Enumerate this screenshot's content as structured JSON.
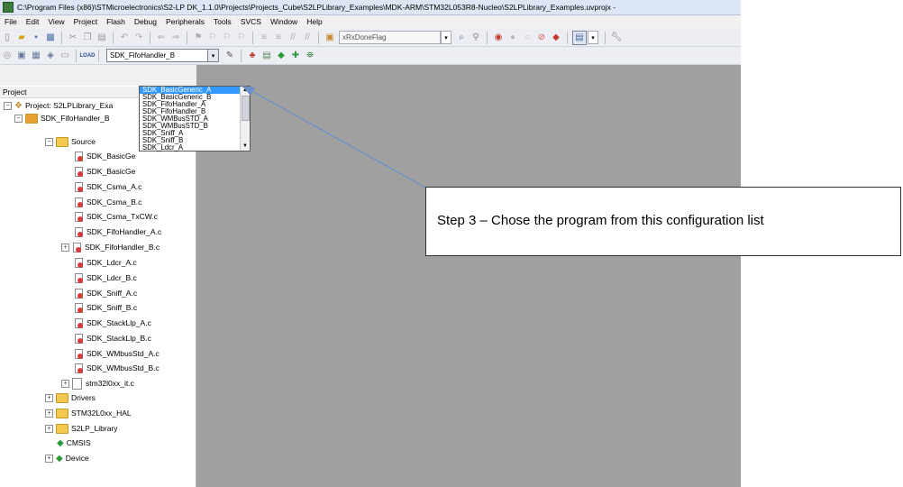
{
  "window": {
    "title": "C:\\Program Files (x86)\\STMicroelectronics\\S2-LP DK_1.1.0\\Projects\\Projects_Cube\\S2LPLibrary_Examples\\MDK-ARM\\STM32L053R8-Nucleo\\S2LPLibrary_Examples.uvprojx -"
  },
  "menu": [
    "File",
    "Edit",
    "View",
    "Project",
    "Flash",
    "Debug",
    "Peripherals",
    "Tools",
    "SVCS",
    "Window",
    "Help"
  ],
  "toolbar1": {
    "find_value": "xRxDoneFlag",
    "icons": [
      "new-file-icon",
      "open-folder-icon",
      "save-icon",
      "save-all-icon",
      "cut-icon",
      "copy-icon",
      "paste-icon",
      "undo-icon",
      "redo-icon",
      "nav-back-icon",
      "nav-forward-icon",
      "bookmark-icon",
      "prev-bookmark-icon",
      "next-bookmark-icon",
      "clear-bookmarks-icon",
      "indent-icon",
      "unindent-icon",
      "comment-icon",
      "uncomment-icon",
      "find-in-files-icon"
    ]
  },
  "toolbar2": {
    "target_value": "SDK_FifoHandler_B",
    "load_label": "LOAD"
  },
  "project_panel": {
    "header": "Project",
    "project_label": "Project: S2LPLibrary_Exa",
    "target_label": "SDK_FifoHandler_B",
    "source_label": "Source",
    "files": [
      "SDK_BasicGe",
      "SDK_BasicGe",
      "SDK_Csma_A.c",
      "SDK_Csma_B.c",
      "SDK_Csma_TxCW.c",
      "SDK_FifoHandler_A.c",
      "SDK_FifoHandler_B.c",
      "SDK_Ldcr_A.c",
      "SDK_Ldcr_B.c",
      "SDK_Sniff_A.c",
      "SDK_Sniff_B.c",
      "SDK_StackLlp_A.c",
      "SDK_StackLlp_B.c",
      "SDK_WMbusStd_A.c",
      "SDK_WMbusStd_B.c",
      "stm32l0xx_it.c"
    ],
    "groups": [
      "Drivers",
      "STM32L0xx_HAL",
      "S2LP_Library",
      "CMSIS",
      "Device"
    ]
  },
  "target_dropdown": {
    "options": [
      "SDK_BasicGeneric_A",
      "SDK_BasicGeneric_B",
      "SDK_FifoHandler_A",
      "SDK_FifoHandler_B",
      "SDK_WMBusSTD_A",
      "SDK_WMBusSTD_B",
      "SDK_Sniff_A",
      "SDK_Sniff_B",
      "SDK_Ldcr_A"
    ],
    "selected_index": 0
  },
  "callout": {
    "text": "Step 3 – Chose the program from this configuration list"
  },
  "colors": {
    "selection": "#3399ff",
    "editor_bg": "#a0a0a0",
    "arrow": "#6a8fc8"
  }
}
